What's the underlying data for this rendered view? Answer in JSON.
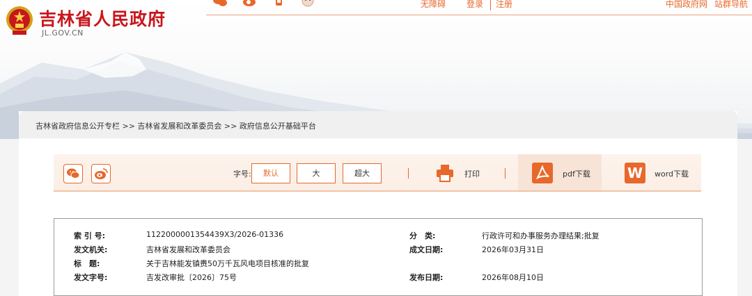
{
  "header": {
    "site_title": "吉林省人民政府",
    "site_domain": "JL.GOV.CN",
    "links": {
      "accessibility": "无障碍",
      "login": "登录",
      "register": "注册",
      "gov_portal": "中国政府网",
      "site_nav": "站群导航"
    }
  },
  "breadcrumb": {
    "text": "吉林省政府信息公开专栏 >> 吉林省发展和改革委员会 >> 政府信息公开基础平台"
  },
  "toolbar": {
    "font_size_label": "字号:",
    "font_sizes": [
      "默认",
      "大",
      "超大"
    ],
    "print_label": "打印",
    "pdf_label": "pdf下载",
    "word_label": "word下载",
    "word_icon_letter": "W",
    "accent_color": "#e8682b"
  },
  "meta": {
    "index_label": "索 引 号:",
    "index_value": "1122000001354439X3/2026-01336",
    "category_label": "分　类:",
    "category_value": "行政许可和办事服务办理结果;批复",
    "issuer_label": "发文机关:",
    "issuer_value": "吉林省发展和改革委员会",
    "date_label": "成文日期:",
    "date_value": "2026年03月31日",
    "title_label": "标　题:",
    "title_value": "关于吉林能发镇赉50万千瓦风电项目核准的批复",
    "doc_no_label": "发文字号:",
    "doc_no_value": "吉发改审批〔2026〕75号",
    "publish_label": "发布日期:",
    "publish_value": "2026年08月10日"
  }
}
